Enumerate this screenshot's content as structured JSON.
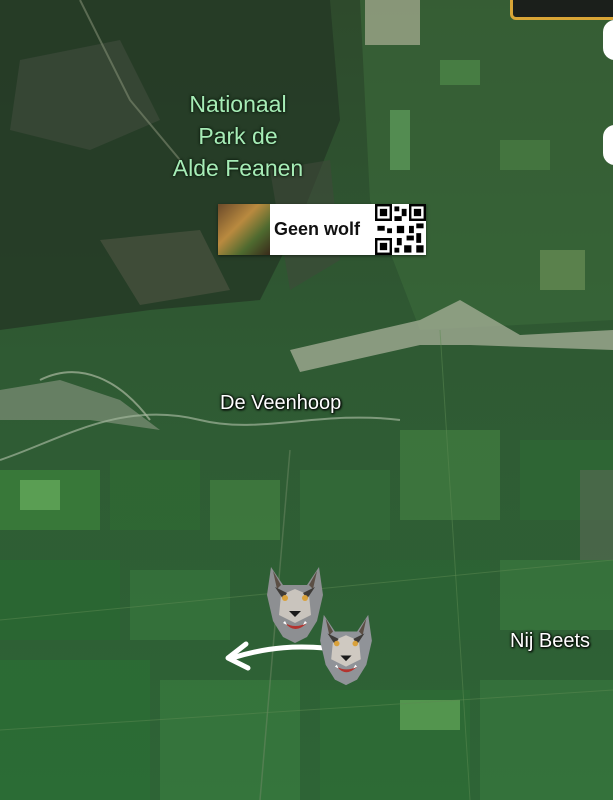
{
  "map": {
    "places": {
      "park_line1": "Nationaal",
      "park_line2": "Park de",
      "park_line3": "Alde Feanen",
      "village_center": "De Veenhoop",
      "village_east": "Nij Beets"
    },
    "marker": {
      "text": "Geen wolf"
    },
    "colors": {
      "park_label": "#a6ecb6",
      "place_label": "#ffffff",
      "arrow": "#ffffff",
      "frame": "#d8a536"
    },
    "icons": [
      "wolf-icon",
      "wolf-icon",
      "arrow-left-icon",
      "qr-code-icon",
      "photo-thumbnail"
    ]
  }
}
